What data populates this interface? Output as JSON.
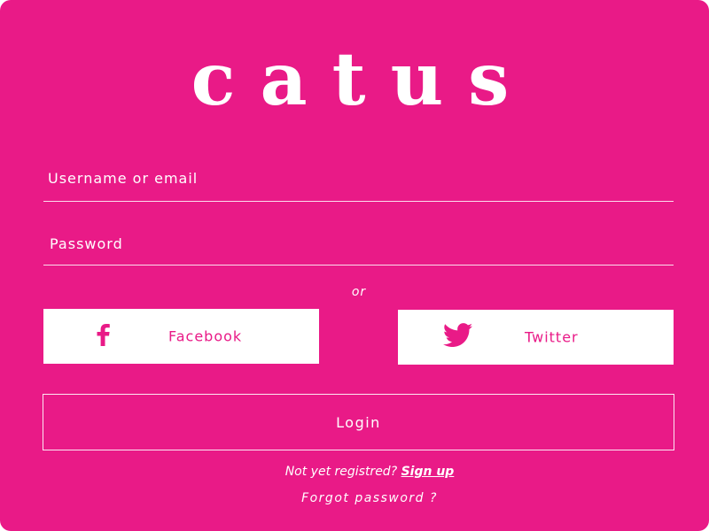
{
  "brand": {
    "logo": "catus",
    "color": "#e91a87"
  },
  "form": {
    "username_placeholder": "Username or email",
    "username_value": "",
    "password_placeholder": "Password",
    "password_value": "",
    "divider": "or"
  },
  "social": {
    "facebook": {
      "label": "Facebook",
      "icon": "facebook-icon"
    },
    "twitter": {
      "label": "Twitter",
      "icon": "twitter-icon"
    }
  },
  "actions": {
    "login_label": "Login",
    "register_prompt": "Not yet registred?",
    "signup_link": "Sign up",
    "forgot_password": "Forgot password ?"
  }
}
